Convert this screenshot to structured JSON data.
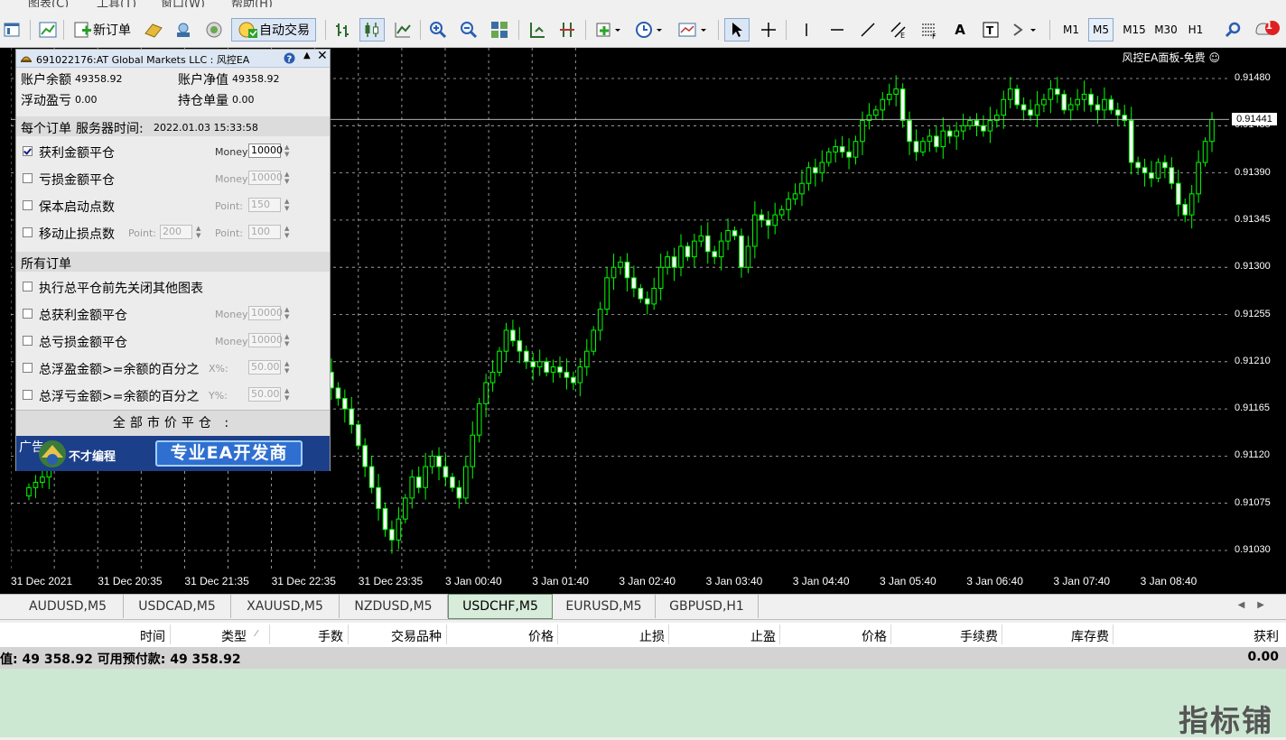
{
  "menubar": [
    "图表(C)",
    "工具(T)",
    "窗口(W)",
    "帮助(H)"
  ],
  "toolbar": {
    "new_order_label": "新订单",
    "auto_trading_label": "自动交易",
    "timeframes": [
      "M1",
      "M5",
      "M15",
      "M30",
      "H1"
    ],
    "active_timeframe": "M5",
    "notification_count": "1"
  },
  "chart": {
    "symbol_tab": "USDCHF,M5",
    "ea_label": "风控EA面板-免费 ☺",
    "current_price": "0.91441",
    "price_ticks": [
      "0.91480",
      "0.91435",
      "0.91390",
      "0.91345",
      "0.91300",
      "0.91255",
      "0.91210",
      "0.91165",
      "0.91120",
      "0.91075",
      "0.91030"
    ],
    "time_ticks": [
      "31 Dec 2021",
      "31 Dec 20:35",
      "31 Dec 21:35",
      "31 Dec 22:35",
      "31 Dec 23:35",
      "3 Jan 00:40",
      "3 Jan 01:40",
      "3 Jan 02:40",
      "3 Jan 03:40",
      "3 Jan 04:40",
      "3 Jan 05:40",
      "3 Jan 06:40",
      "3 Jan 07:40",
      "3 Jan 08:40"
    ],
    "colors": {
      "background": "#000000",
      "candle_up": "#000000",
      "candle_down": "#ffffff",
      "wick": "#00ff00",
      "grid": "#bbbbbb"
    }
  },
  "panel": {
    "title": "691022176:AT Global Markets LLC : 风控EA",
    "balance_label": "账户余额",
    "balance_value": "49358.92",
    "equity_label": "账户净值",
    "equity_value": "49358.92",
    "floating_label": "浮动盈亏",
    "floating_value": "0.00",
    "positions_label": "持仓单量",
    "positions_value": "0.00",
    "section1": "每个订单",
    "server_time_label": "服务器时间:",
    "server_time": "2022.01.03 15:33:58",
    "take_profit_amount": {
      "label": "获利金额平仓",
      "sub": "Money",
      "value": "10000",
      "checked": true
    },
    "stop_loss_amount": {
      "label": "亏损金额平仓",
      "sub": "Money",
      "value": "10000",
      "checked": false
    },
    "breakeven": {
      "label": "保本启动点数",
      "sub": "Point:",
      "value": "150",
      "checked": false
    },
    "trailing": {
      "label": "移动止损点数",
      "sub1": "Point:",
      "value1": "200",
      "sub2": "Point:",
      "value2": "100",
      "checked": false
    },
    "section2": "所有订单",
    "close_other": {
      "label": "执行总平仓前先关闭其他图表",
      "checked": false
    },
    "total_profit": {
      "label": "总获利金额平仓",
      "sub": "Money",
      "value": "10000",
      "checked": false
    },
    "total_loss": {
      "label": "总亏损金额平仓",
      "sub": "Money",
      "value": "10000",
      "checked": false
    },
    "float_profit_pct": {
      "label": "总浮盈金额>=余额的百分之",
      "sub": "X%:",
      "value": "50.00",
      "checked": false
    },
    "float_loss_pct": {
      "label": "总浮亏金额>=余额的百分之",
      "sub": "Y%:",
      "value": "50.00",
      "checked": false
    },
    "close_all": "全部市价平仓 :",
    "ad_label": "广告",
    "ad_brand": "不才编程",
    "ad_slogan": "专业EA开发商"
  },
  "tabs": [
    "AUDUSD,M5",
    "USDCAD,M5",
    "XAUUSD,M5",
    "NZDUSD,M5",
    "USDCHF,M5",
    "EURUSD,M5",
    "GBPUSD,H1"
  ],
  "active_tab": "USDCHF,M5",
  "table": {
    "columns": [
      "时间",
      "类型",
      "手数",
      "交易品种",
      "价格",
      "止损",
      "止盈",
      "价格",
      "手续费",
      "库存费",
      "获利"
    ],
    "balance_text": "值: 49 358.92  可用预付款: 49 358.92",
    "total_profit": "0.00"
  },
  "watermark": "指标铺"
}
